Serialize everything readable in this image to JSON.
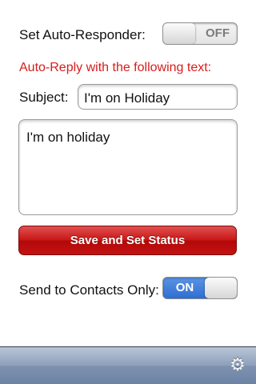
{
  "auto_responder": {
    "label": "Set Auto-Responder:",
    "toggle_text": "OFF"
  },
  "auto_reply": {
    "heading": "Auto-Reply with the following text:",
    "subject_label": "Subject:",
    "subject_value": "I'm on Holiday",
    "body_text": "I'm on holiday"
  },
  "save_button": {
    "label": "Save and Set Status"
  },
  "contacts_only": {
    "label": "Send to Contacts Only:",
    "toggle_text": "ON"
  },
  "toolbar": {
    "settings_icon": "gear-icon"
  },
  "colors": {
    "heading_red": "#d71c1c",
    "button_red": "#c81515",
    "toggle_on_blue": "#2e6ed3",
    "toolbar_blue": "#8d9fba"
  }
}
